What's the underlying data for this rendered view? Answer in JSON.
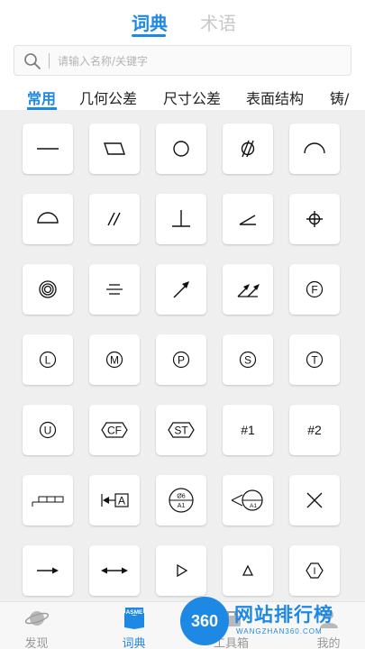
{
  "top_tabs": [
    {
      "label": "词典",
      "active": true
    },
    {
      "label": "术语",
      "active": false
    }
  ],
  "search": {
    "placeholder": "请输入名称/关键字",
    "value": ""
  },
  "categories": [
    {
      "label": "常用",
      "active": true
    },
    {
      "label": "几何公差",
      "active": false
    },
    {
      "label": "尺寸公差",
      "active": false
    },
    {
      "label": "表面结构",
      "active": false
    },
    {
      "label": "铸/",
      "active": false
    }
  ],
  "symbols": [
    {
      "icon": "straightness-icon"
    },
    {
      "icon": "flatness-icon"
    },
    {
      "icon": "circularity-icon"
    },
    {
      "icon": "cylindricity-icon"
    },
    {
      "icon": "profile-of-line-icon"
    },
    {
      "icon": "profile-of-surface-icon"
    },
    {
      "icon": "parallelism-icon"
    },
    {
      "icon": "perpendicularity-icon"
    },
    {
      "icon": "angularity-icon"
    },
    {
      "icon": "position-icon"
    },
    {
      "icon": "concentricity-icon"
    },
    {
      "icon": "symmetry-icon"
    },
    {
      "icon": "circular-runout-icon"
    },
    {
      "icon": "total-runout-icon"
    },
    {
      "icon": "free-state-icon",
      "text": "F"
    },
    {
      "icon": "lmc-icon",
      "text": "L"
    },
    {
      "icon": "mmc-icon",
      "text": "M"
    },
    {
      "icon": "projected-tolerance-zone-icon",
      "text": "P"
    },
    {
      "icon": "rfs-icon",
      "text": "S"
    },
    {
      "icon": "tangent-plane-icon",
      "text": "T"
    },
    {
      "icon": "unequally-disposed-icon",
      "text": "U"
    },
    {
      "icon": "continuous-feature-icon",
      "text": "CF"
    },
    {
      "icon": "statistical-tolerance-icon",
      "text": "ST"
    },
    {
      "icon": "hash-1-icon",
      "text": "#1"
    },
    {
      "icon": "hash-2-icon",
      "text": "#2"
    },
    {
      "icon": "feature-control-frame-icon"
    },
    {
      "icon": "datum-feature-icon",
      "text": "A"
    },
    {
      "icon": "datum-target-icon",
      "top": "Ø6",
      "bottom": "A1"
    },
    {
      "icon": "datum-target-leader-icon",
      "text": "A1"
    },
    {
      "icon": "datum-target-point-icon"
    },
    {
      "icon": "from-to-arrow-icon"
    },
    {
      "icon": "between-arrows-icon"
    },
    {
      "icon": "open-triangle-icon"
    },
    {
      "icon": "triangle-icon"
    },
    {
      "icon": "independency-icon",
      "text": "I"
    }
  ],
  "bottom_nav": [
    {
      "label": "发现",
      "icon": "planet-icon",
      "active": false
    },
    {
      "label": "词典",
      "icon": "asme-book-icon",
      "active": true
    },
    {
      "label": "工具箱",
      "icon": "toolbox-icon",
      "active": false
    },
    {
      "label": "",
      "icon": "blank-icon",
      "active": false
    },
    {
      "label": "我的",
      "icon": "user-icon",
      "active": false
    }
  ],
  "asme_badge": "ASME",
  "watermark": {
    "badge": "360",
    "title": "网站排行榜",
    "subtitle": "WANGZHAN360.COM"
  },
  "colors": {
    "accent": "#1e88e5",
    "grid_bg": "#efefef"
  }
}
